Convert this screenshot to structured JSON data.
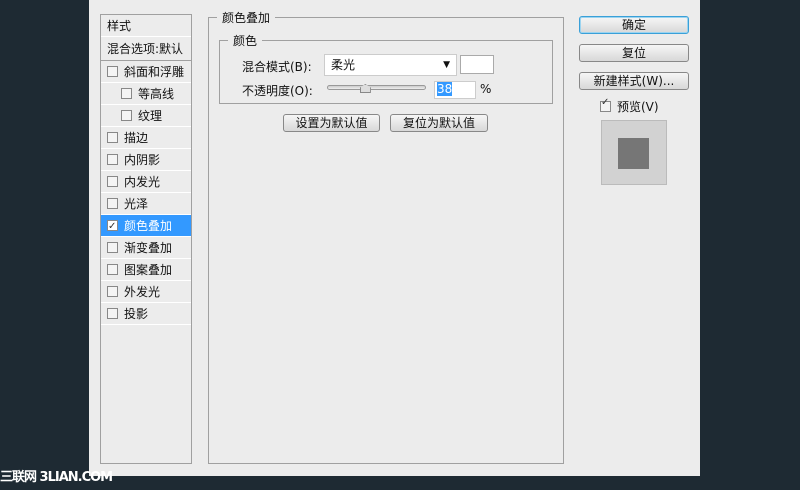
{
  "sidebar": {
    "header": "样式",
    "blend": "混合选项:默认",
    "items": [
      {
        "label": "斜面和浮雕",
        "checked": false
      },
      {
        "label": "等高线",
        "checked": false
      },
      {
        "label": "纹理",
        "checked": false
      },
      {
        "label": "描边",
        "checked": false
      },
      {
        "label": "内阴影",
        "checked": false
      },
      {
        "label": "内发光",
        "checked": false
      },
      {
        "label": "光泽",
        "checked": false
      },
      {
        "label": "颜色叠加",
        "checked": true
      },
      {
        "label": "渐变叠加",
        "checked": false
      },
      {
        "label": "图案叠加",
        "checked": false
      },
      {
        "label": "外发光",
        "checked": false
      },
      {
        "label": "投影",
        "checked": false
      }
    ]
  },
  "panel": {
    "title": "颜色叠加",
    "group": "颜色",
    "blend_label": "混合模式(B):",
    "blend_value": "柔光",
    "opacity_label": "不透明度(O):",
    "opacity_value": "38",
    "opacity_unit": "%",
    "opacity_fraction": 0.38,
    "set_default": "设置为默认值",
    "reset_default": "复位为默认值",
    "swatch_color": "#ffffff"
  },
  "buttons": {
    "ok": "确定",
    "reset": "复位",
    "new_style": "新建样式(W)...",
    "preview": "预览(V)",
    "preview_checked": true
  },
  "watermark": "三联网 3LIAN.COM"
}
